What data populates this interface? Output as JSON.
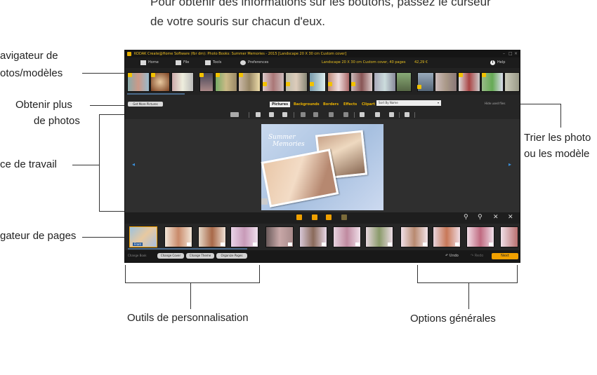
{
  "doc": {
    "intro_line1": "Pour obtenir des informations sur les boutons, passez le curseur",
    "intro_line2": "de votre souris sur chacun d'eux."
  },
  "callouts": {
    "navigator_line1": "avigateur de",
    "navigator_line2": "otos/modèles",
    "get_more_line1": "Obtenir plus",
    "get_more_line2": "de photos",
    "workspace": "ce de travail",
    "page_navigator": "gateur de pages",
    "sort_line1": "Trier les photo",
    "sort_line2": "ou les modèle",
    "customization_tools": "Outils de personnalisation",
    "general_options": "Options générales"
  },
  "app": {
    "title": "KODAK Create@Home Software (fbr dm): Photo Books: Summer Memories - 2015 [Landscape 20 X 30 cm Custom cover]",
    "menu": {
      "home": "Home",
      "file": "File",
      "tools": "Tools",
      "preferences": "Preferences",
      "help": "Help"
    },
    "status": "Landscape 20 X 30 cm Custom cover, 40 pages",
    "price": "42,29 €",
    "get_more_button": "Get More Pictures",
    "tabs": [
      "Pictures",
      "Backgrounds",
      "Borders",
      "Effects",
      "Clipart"
    ],
    "sort_value": "Sort By Name",
    "hide_used": "Hide used files",
    "page_title_line1": "Summer",
    "page_title_line2": "Memories",
    "bottom": {
      "change_book": "Change Book",
      "change_cover": "Change Cover",
      "change_theme": "Change Theme",
      "organize_pages": "Organize Pages",
      "undo": "Undo",
      "redo": "Redo",
      "next": "Next"
    },
    "cover_label": "Front"
  },
  "colors": {
    "accent": "#f0a000",
    "tab_text": "#e8b000",
    "arrow": "#3a8fd8"
  }
}
